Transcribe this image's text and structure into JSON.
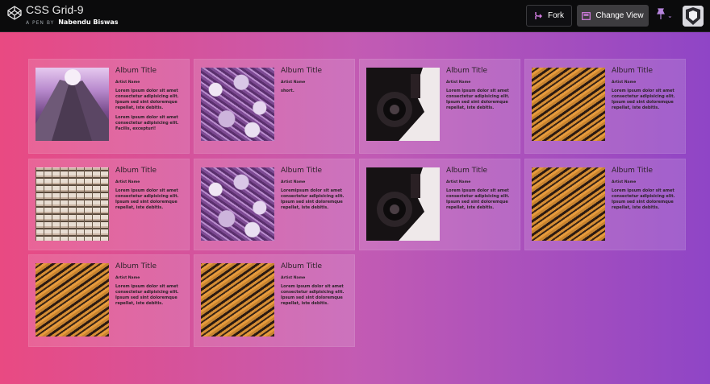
{
  "header": {
    "pen_title": "CSS Grid-9",
    "byline_prefix": "A PEN BY",
    "author": "Nabendu Biswas",
    "fork_label": "Fork",
    "change_view_label": "Change View",
    "caret": "⌄"
  },
  "colors": {
    "gradient_start": "#e94a82",
    "gradient_end": "#8f45c6",
    "header_bg": "#0b0b0c",
    "pin_color": "#b785dd"
  },
  "cards": [
    {
      "title": "Album Title",
      "artist": "Artist Name",
      "image": "skyscraper-image",
      "desc": "Lorem ipsum dolor sit amet consectetur adipisicing elit. Ipsum sed sint doloremque repellat, iste debitis.",
      "desc2": "Lorem ipsum dolor sit amet consectetur adipisicing elit. Facilis, excepturi!"
    },
    {
      "title": "Album Title",
      "artist": "Artist Name",
      "image": "bikes-image",
      "desc": "short."
    },
    {
      "title": "Album Title",
      "artist": "Artist Name",
      "image": "camera-image",
      "desc": "Lorem ipsum dolor sit amet consectetur adipisicing elit. Ipsum sed sint doloremque repellat, iste debitis."
    },
    {
      "title": "Album Title",
      "artist": "Artist Name",
      "image": "tiger-stripes-image",
      "desc": "Lorem ipsum dolor sit amet consectetur adipisicing elit. Ipsum sed sint doloremque repellat, iste debitis."
    },
    {
      "title": "Album Title",
      "artist": "Artist Name",
      "image": "building-image",
      "desc": "Lorem ipsum dolor sit amet consectetur adipisicing elit. Ipsum sed sint doloremque repellat, iste debitis."
    },
    {
      "title": "Album Title",
      "artist": "Artist Name",
      "image": "bikes-image",
      "desc": "Loremipsum dolor sit amet consectetur adipisicing elit. Ipsum sed sint doloremque repellat, iste debitis."
    },
    {
      "title": "Album Title",
      "artist": "Artist Name",
      "image": "camera-image",
      "desc": "Lorem ipsum dolor sit amet consectetur adipisicing elit. Ipsum sed sint doloremque repellat, iste debitis."
    },
    {
      "title": "Album Title",
      "artist": "Artist Name",
      "image": "tiger-stripes-image",
      "desc": "Lorem ipsum dolor sit amet consectetur adipisicing elit. Ipsum sed sint doloremque repellat, iste debitis."
    },
    {
      "title": "Album Title",
      "artist": "Artist Name",
      "image": "tiger-stripes-image",
      "desc": "Lorem ipsum dolor sit amet consectetur adipisicing elit. Ipsum sed sint doloremque repellat, iste debitis."
    },
    {
      "title": "Album Title",
      "artist": "Artist Name",
      "image": "tiger-stripes-image",
      "desc": "Lorem ipsum dolor sit amet consectetur adipisicing elit. Ipsum sed sint doloremque repellat, iste debitis."
    }
  ]
}
